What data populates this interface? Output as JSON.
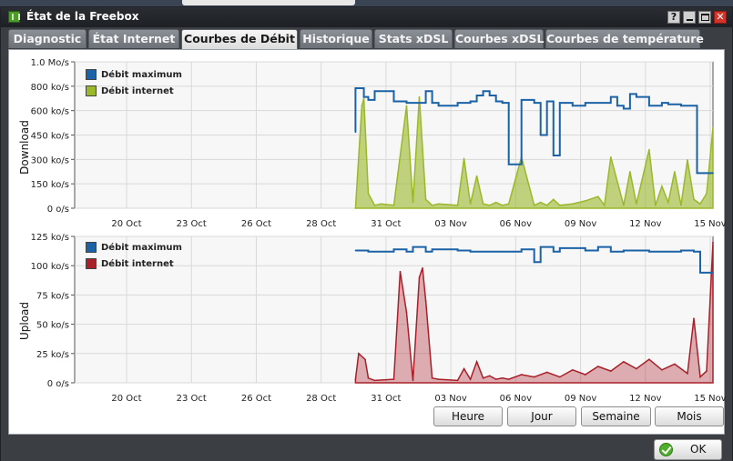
{
  "window": {
    "title": "État de la Freebox"
  },
  "controls": {
    "help": "?",
    "minimize": "",
    "maximize": "",
    "close": "✕"
  },
  "tabs": [
    {
      "label": "Diagnostic",
      "active": false
    },
    {
      "label": "État Internet",
      "active": false
    },
    {
      "label": "Courbes de Débit",
      "active": true
    },
    {
      "label": "Historique",
      "active": false
    },
    {
      "label": "Stats xDSL",
      "active": false
    },
    {
      "label": "Courbes xDSL",
      "active": false
    },
    {
      "label": "Courbes de température",
      "active": false
    }
  ],
  "range_buttons": {
    "heure": "Heure",
    "jour": "Jour",
    "semaine": "Semaine",
    "mois": "Mois"
  },
  "ok_button": {
    "label": "OK"
  },
  "colors": {
    "max_line": "#1b62a6",
    "download_fill": "#9ab82a",
    "upload_fill": "#a8202a",
    "grid": "#d9d9d9"
  },
  "chart_data": [
    {
      "type": "area",
      "ylabel": "Download",
      "yticks": [
        "0 o/s",
        "150 ko/s",
        "300 ko/s",
        "450 ko/s",
        "600 ko/s",
        "800 ko/s",
        "1.0 Mo/s"
      ],
      "ylim": [
        0,
        1000
      ],
      "xticks": [
        "20 Oct",
        "23 Oct",
        "26 Oct",
        "28 Oct",
        "31 Oct",
        "03 Nov",
        "06 Nov",
        "09 Nov",
        "12 Nov",
        "15 Nov"
      ],
      "grid": true,
      "legend_position": "top-left",
      "series": [
        {
          "name": "Débit maximum",
          "color": "#1b62a6",
          "x": [
            0.44,
            0.44,
            0.453,
            0.46,
            0.47,
            0.5,
            0.52,
            0.55,
            0.56,
            0.57,
            0.6,
            0.62,
            0.63,
            0.64,
            0.65,
            0.66,
            0.67,
            0.68,
            0.7,
            0.72,
            0.73,
            0.74,
            0.75,
            0.76,
            0.77,
            0.78,
            0.8,
            0.83,
            0.84,
            0.85,
            0.86,
            0.87,
            0.88,
            0.9,
            0.92,
            0.93,
            0.95,
            0.97,
            0.975,
            1.0
          ],
          "values": [
            520,
            820,
            760,
            740,
            800,
            730,
            720,
            800,
            720,
            700,
            720,
            730,
            770,
            800,
            770,
            730,
            720,
            300,
            740,
            720,
            500,
            730,
            360,
            720,
            720,
            700,
            720,
            720,
            760,
            700,
            680,
            780,
            760,
            700,
            720,
            710,
            700,
            700,
            240,
            240
          ]
        },
        {
          "name": "Débit internet",
          "color": "#9ab82a",
          "x": [
            0.44,
            0.45,
            0.453,
            0.46,
            0.47,
            0.48,
            0.5,
            0.52,
            0.53,
            0.54,
            0.55,
            0.56,
            0.57,
            0.6,
            0.61,
            0.62,
            0.63,
            0.64,
            0.65,
            0.66,
            0.67,
            0.68,
            0.7,
            0.72,
            0.73,
            0.74,
            0.75,
            0.76,
            0.78,
            0.8,
            0.82,
            0.83,
            0.84,
            0.86,
            0.87,
            0.88,
            0.9,
            0.91,
            0.92,
            0.93,
            0.94,
            0.95,
            0.96,
            0.97,
            0.98,
            0.99,
            1.0
          ],
          "values": [
            0,
            700,
            750,
            100,
            20,
            30,
            20,
            700,
            40,
            760,
            60,
            20,
            30,
            20,
            340,
            30,
            220,
            30,
            20,
            40,
            20,
            30,
            350,
            20,
            40,
            20,
            60,
            20,
            30,
            50,
            80,
            20,
            350,
            20,
            250,
            30,
            400,
            20,
            150,
            40,
            250,
            20,
            330,
            60,
            30,
            100,
            550
          ]
        }
      ]
    },
    {
      "type": "area",
      "ylabel": "Upload",
      "yticks": [
        "0 o/s",
        "25 ko/s",
        "50 ko/s",
        "75 ko/s",
        "100 ko/s",
        "125 ko/s"
      ],
      "ylim": [
        0,
        125
      ],
      "xticks": [
        "20 Oct",
        "23 Oct",
        "26 Oct",
        "28 Oct",
        "31 Oct",
        "03 Nov",
        "06 Nov",
        "09 Nov",
        "12 Nov",
        "15 Nov"
      ],
      "grid": true,
      "legend_position": "top-left",
      "series": [
        {
          "name": "Débit maximum",
          "color": "#1b62a6",
          "x": [
            0.44,
            0.46,
            0.5,
            0.52,
            0.53,
            0.55,
            0.56,
            0.6,
            0.62,
            0.7,
            0.72,
            0.73,
            0.75,
            0.76,
            0.8,
            0.82,
            0.84,
            0.86,
            0.9,
            0.95,
            0.97,
            0.98,
            1.0
          ],
          "values": [
            113,
            112,
            114,
            112,
            116,
            112,
            114,
            113,
            112,
            114,
            103,
            116,
            112,
            115,
            113,
            116,
            112,
            113,
            112,
            113,
            112,
            94,
            94
          ]
        },
        {
          "name": "Débit internet",
          "color": "#a8202a",
          "x": [
            0.44,
            0.445,
            0.455,
            0.46,
            0.47,
            0.5,
            0.51,
            0.52,
            0.53,
            0.54,
            0.545,
            0.55,
            0.56,
            0.57,
            0.6,
            0.61,
            0.62,
            0.63,
            0.64,
            0.65,
            0.66,
            0.67,
            0.68,
            0.7,
            0.72,
            0.74,
            0.76,
            0.78,
            0.8,
            0.82,
            0.84,
            0.86,
            0.88,
            0.9,
            0.92,
            0.94,
            0.96,
            0.97,
            0.98,
            0.99,
            1.0
          ],
          "values": [
            3,
            25,
            20,
            4,
            2,
            3,
            95,
            60,
            2,
            90,
            98,
            70,
            4,
            3,
            2,
            12,
            3,
            18,
            4,
            6,
            3,
            4,
            3,
            7,
            5,
            9,
            5,
            11,
            7,
            14,
            10,
            18,
            12,
            20,
            11,
            16,
            8,
            55,
            5,
            10,
            120
          ]
        }
      ]
    }
  ]
}
